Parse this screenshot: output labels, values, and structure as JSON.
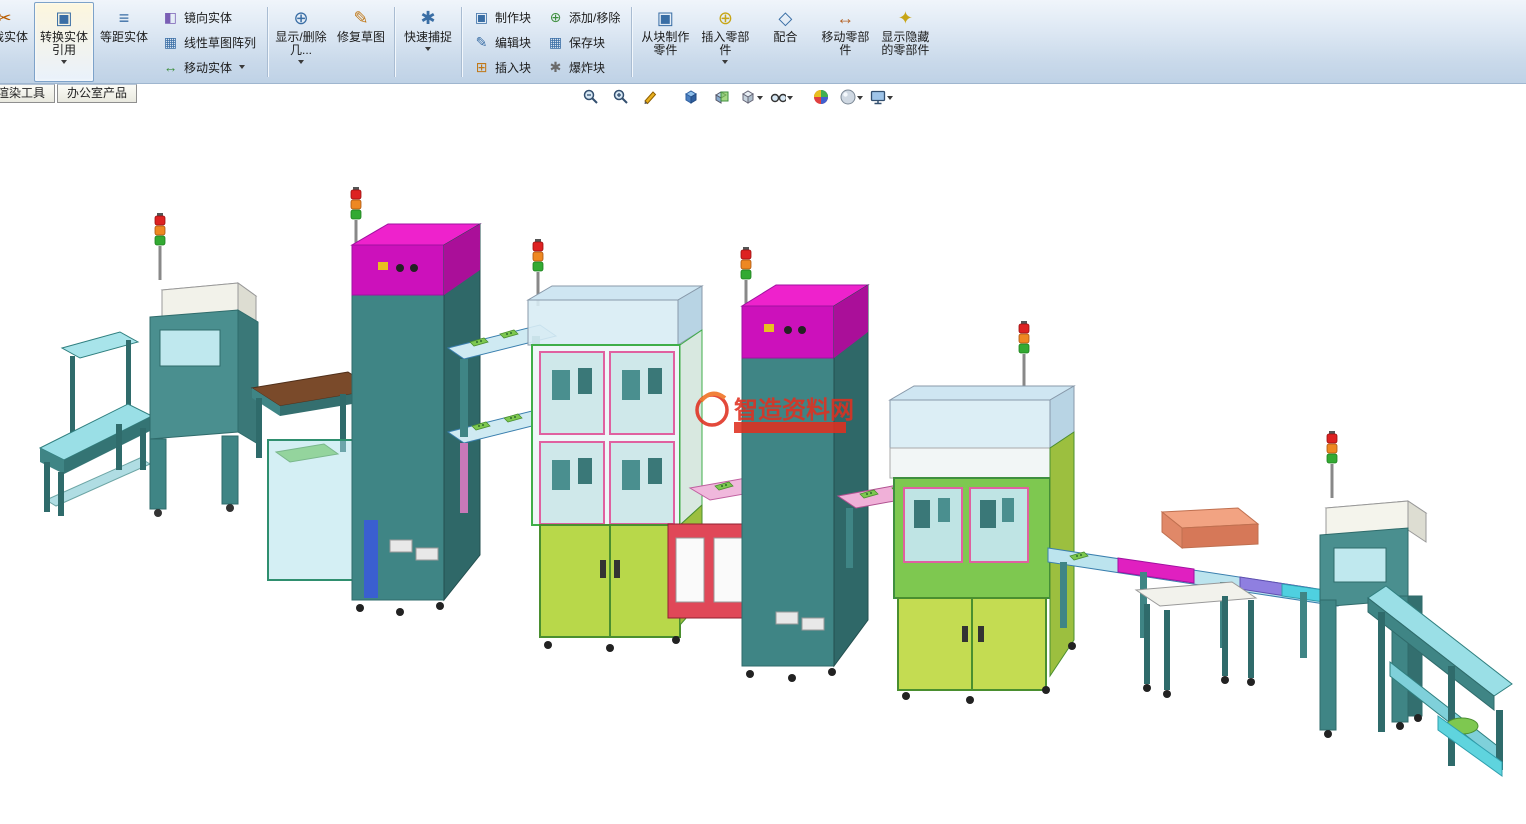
{
  "ribbon": {
    "items": [
      {
        "label": "剪裁实体",
        "icon": "trim-entities-icon",
        "glyph": "✂",
        "color": "#b85c00"
      },
      {
        "label": "转换实体引用",
        "icon": "convert-entities-icon",
        "glyph": "▣",
        "color": "#3a6ea5",
        "selected": "true"
      },
      {
        "label": "等距实体",
        "icon": "offset-entities-icon",
        "glyph": "≡",
        "color": "#3a6ea5"
      },
      {
        "label": "镜向实体",
        "icon": "mirror-entities-icon",
        "glyph": "◧",
        "color": "#7a5fb5"
      },
      {
        "label": "线性草图阵列",
        "icon": "linear-sketch-pattern-icon",
        "glyph": "▦",
        "color": "#3a6ea5"
      },
      {
        "label": "移动实体",
        "icon": "move-entities-icon",
        "glyph": "↔",
        "color": "#3f8f3f"
      },
      {
        "label": "显示/删除几...",
        "icon": "display-delete-relations-icon",
        "glyph": "⊕",
        "color": "#3a6ea5"
      },
      {
        "label": "修复草图",
        "icon": "repair-sketch-icon",
        "glyph": "✎",
        "color": "#c07818"
      },
      {
        "label": "快速捕捉",
        "icon": "quick-snaps-icon",
        "glyph": "✱",
        "color": "#3a6ea5"
      },
      {
        "label": "制作块",
        "icon": "make-block-icon",
        "glyph": "▣",
        "color": "#3a6ea5"
      },
      {
        "label": "编辑块",
        "icon": "edit-block-icon",
        "glyph": "✎",
        "color": "#3a6ea5"
      },
      {
        "label": "插入块",
        "icon": "insert-block-icon",
        "glyph": "⊞",
        "color": "#c07818"
      },
      {
        "label": "添加/移除",
        "icon": "add-remove-icon",
        "glyph": "⊕",
        "color": "#3f8f3f"
      },
      {
        "label": "保存块",
        "icon": "save-block-icon",
        "glyph": "▦",
        "color": "#3a6ea5"
      },
      {
        "label": "爆炸块",
        "icon": "explode-block-icon",
        "glyph": "✱",
        "color": "#6a6a6a"
      },
      {
        "label": "从块制作零件",
        "icon": "make-part-from-block-icon",
        "glyph": "▣",
        "color": "#3a6ea5"
      },
      {
        "label": "插入零部件",
        "icon": "insert-components-icon",
        "glyph": "⊕",
        "color": "#c7a516"
      },
      {
        "label": "配合",
        "icon": "mate-icon",
        "glyph": "◇",
        "color": "#3a6ea5"
      },
      {
        "label": "移动零部件",
        "icon": "move-component-icon",
        "glyph": "↔",
        "color": "#b5652a"
      },
      {
        "label": "显示隐藏的零部件",
        "icon": "show-hidden-components-icon",
        "glyph": "✦",
        "color": "#c7a516"
      }
    ]
  },
  "tabs": [
    {
      "label": "渲染工具"
    },
    {
      "label": "办公室产品"
    }
  ],
  "viewbar": {
    "icons": [
      "zoom-to-fit-icon",
      "zoom-to-area-icon",
      "pencil-icon",
      "view-orientation-cube-icon",
      "section-view-icon",
      "display-style-cube-icon",
      "hide-show-items-glasses-icon",
      "edit-appearance-ball-icon",
      "apply-scene-ball-icon",
      "view-settings-monitor-icon"
    ]
  },
  "watermark": {
    "text": "智造资料网",
    "color": "#e03020"
  },
  "scene": {
    "machines": [
      "infeed-conveyor",
      "press-machine-1",
      "transfer-table",
      "tall-cabinet-1",
      "conveyor-tier",
      "inspection-machine-1",
      "mid-conveyor",
      "red-cabinet",
      "tall-cabinet-2",
      "conveyor-3",
      "inspection-machine-2",
      "exit-conveyor-line",
      "buffer-table",
      "press-machine-2",
      "outfeed-conveyor"
    ],
    "signal_tower_colors": [
      "#dd2222",
      "#ee8822",
      "#33aa33"
    ],
    "palette": {
      "teal": "#3f8585",
      "magenta": "#ee22cc",
      "glass": "#cfe6f2",
      "door_green": "#b8d84a",
      "frame_green": "#3fae49",
      "pink": "#f0b0d8",
      "red_cabinet": "#e04858"
    }
  }
}
